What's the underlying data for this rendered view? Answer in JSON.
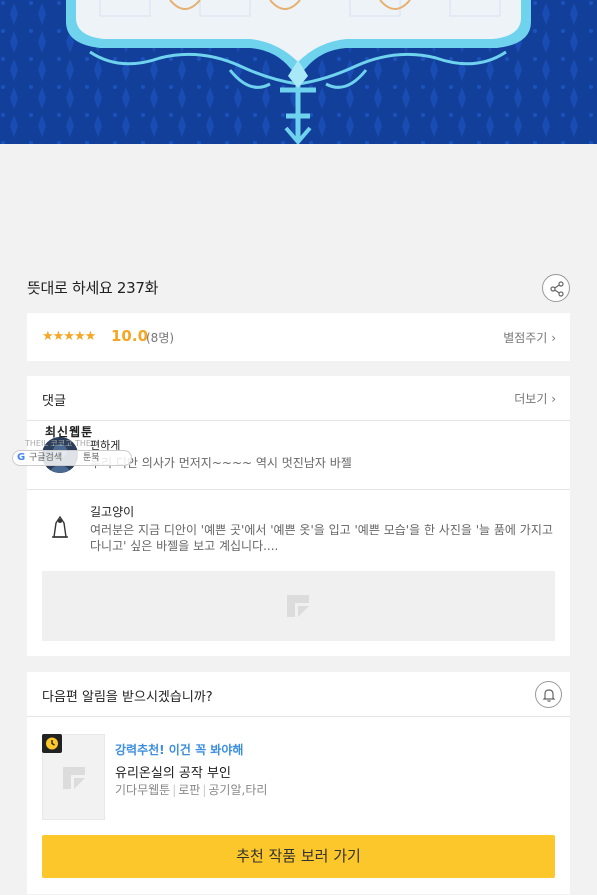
{
  "episode": {
    "title": "뜻대로 하세요 237화"
  },
  "rating": {
    "stars": "★★★★★",
    "score": "10.0",
    "count": "(8명)",
    "rate_label": "별점주기"
  },
  "comments": {
    "header": "댓글",
    "more_label": "더보기",
    "items": [
      {
        "name": "편하게",
        "text": "우리 디안 의사가 먼저지~~~~ 역시 멋진남자 바젤"
      },
      {
        "name": "길고양이",
        "text": "여러분은 지금 디안이 '예쁜 곳'에서 '예쁜 옷'을 입고 '예쁜 모습'을 한 사진을 '늘 품에 가지고 다니고' 싶은 바젤을 보고 계십니다...."
      }
    ]
  },
  "overlay": {
    "tag": "최신웹툰",
    "small_text": "THEIL 코코고  THE",
    "pill_g": "G",
    "pill_text": "구글검색",
    "pill_book": "툰북"
  },
  "notification": {
    "question": "다음편 알림을 받으시겠습니까?"
  },
  "recommendation": {
    "badge": "강력추천! 이건 꼭 봐야해",
    "title": "유리온실의 공작 부인",
    "meta": [
      "기다무웹툰",
      "로판",
      "공기알,타리"
    ],
    "cta": "추천 작품 보러 가기"
  },
  "icons": [
    "share-icon",
    "star-icon",
    "chevron-right-icon",
    "bell-icon",
    "clock-icon",
    "image-placeholder-icon"
  ],
  "colors": {
    "accent_yellow": "#fcc72a",
    "star_orange": "#f5a623",
    "link_blue": "#3c8ee0",
    "banner_blue": "#123f9a"
  }
}
